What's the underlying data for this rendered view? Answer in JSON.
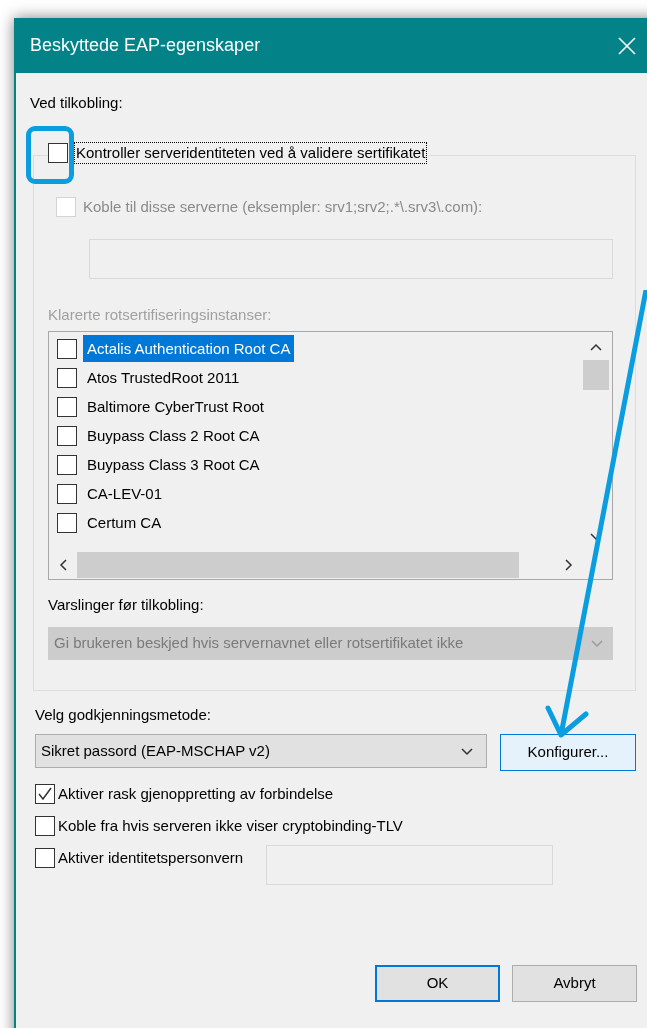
{
  "window": {
    "title": "Beskyttede EAP-egenskaper"
  },
  "on_connect": {
    "label": "Ved tilkobling:",
    "validate": {
      "label": "Kontroller serveridentiteten ved å validere sertifikatet",
      "checked": false
    },
    "connect_to_servers": {
      "label": "Koble til disse serverne (eksempler: srv1;srv2;.*\\.srv3\\.com):",
      "checked": false,
      "disabled": true
    },
    "trusted_label": {
      "text": "Klarerte rotsertifiseringsinstanser:",
      "disabled": true
    },
    "certificates": [
      {
        "name": "Actalis Authentication Root CA",
        "checked": false,
        "selected": true
      },
      {
        "name": "Atos TrustedRoot 2011",
        "checked": false,
        "selected": false
      },
      {
        "name": "Baltimore CyberTrust Root",
        "checked": false,
        "selected": false
      },
      {
        "name": "Buypass Class 2 Root CA",
        "checked": false,
        "selected": false
      },
      {
        "name": "Buypass Class 3 Root CA",
        "checked": false,
        "selected": false
      },
      {
        "name": "CA-LEV-01",
        "checked": false,
        "selected": false
      },
      {
        "name": "Certum CA",
        "checked": false,
        "selected": false
      }
    ],
    "notifications": {
      "label": "Varslinger før tilkobling:",
      "value": "Gi brukeren beskjed hvis servernavnet eller rotsertifikatet ikke",
      "disabled": true
    }
  },
  "auth_method": {
    "label": "Velg godkjenningsmetode:",
    "value": "Sikret passord (EAP-MSCHAP v2)"
  },
  "configure_button": "Konfigurer...",
  "options": [
    {
      "label": "Aktiver rask gjenoppretting av forbindelse",
      "checked": true
    },
    {
      "label": "Koble fra hvis serveren ikke viser cryptobinding-TLV",
      "checked": false
    },
    {
      "label": "Aktiver identitetspersonvern",
      "checked": false,
      "has_field": true
    }
  ],
  "buttons": [
    {
      "label": "OK",
      "default": true
    },
    {
      "label": "Avbryt",
      "default": false
    }
  ]
}
